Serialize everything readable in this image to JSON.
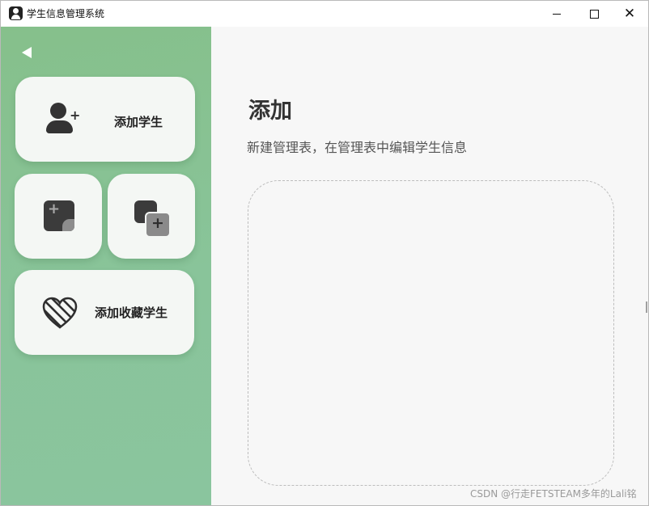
{
  "window": {
    "title": "学生信息管理系统",
    "app_icon": "student-app-icon",
    "controls": [
      "minimize-icon",
      "maximize-icon",
      "close-icon"
    ]
  },
  "sidebar": {
    "background_color": "#86c08b",
    "back_icon": "back-arrow-icon",
    "cards": [
      {
        "label": "添加学生",
        "icon": "user-plus-icon"
      },
      {
        "label": "",
        "icon": "note-plus-icon"
      },
      {
        "label": "",
        "icon": "copy-plus-icon"
      },
      {
        "label": "添加收藏学生",
        "icon": "heart-icon"
      }
    ]
  },
  "main": {
    "title": "添加",
    "subtitle": "新建管理表，在管理表中编辑学生信息",
    "watermark": "CSDN @行走FETSTEAM多年的Lali铭"
  }
}
